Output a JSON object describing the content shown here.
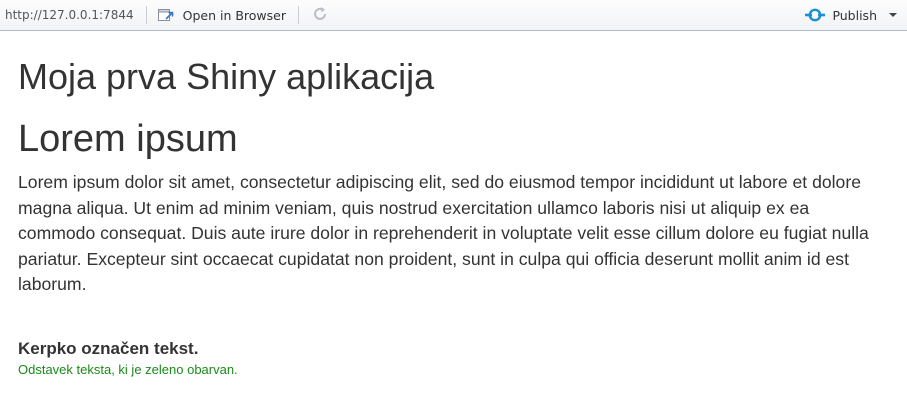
{
  "toolbar": {
    "url": "http://127.0.0.1:7844",
    "open_in_browser_label": "Open in Browser",
    "publish_label": "Publish",
    "colors": {
      "publish_accent": "#1a8fd4",
      "border": "#a9bbd6"
    },
    "icons": {
      "open": "open-in-browser-icon",
      "refresh": "refresh-icon",
      "publish": "publish-icon",
      "caret": "chevron-down-icon"
    }
  },
  "page": {
    "title": "Moja prva Shiny aplikacija",
    "section_heading": "Lorem ipsum",
    "paragraph": "Lorem ipsum dolor sit amet, consectetur adipiscing elit, sed do eiusmod tempor incididunt ut labore et dolore magna aliqua. Ut enim ad minim veniam, quis nostrud exercitation ullamco laboris nisi ut aliquip ex ea commodo consequat. Duis aute irure dolor in reprehenderit in voluptate velit esse cillum dolore eu fugiat nulla pariatur. Excepteur sint occaecat cupidatat non proident, sunt in culpa qui officia deserunt mollit anim id est laborum.",
    "bold_text": "Kerpko označen tekst.",
    "green_text": "Odstavek teksta, ki je zeleno obarvan.",
    "colors": {
      "text": "#333333",
      "green": "#1a8a1a"
    }
  }
}
